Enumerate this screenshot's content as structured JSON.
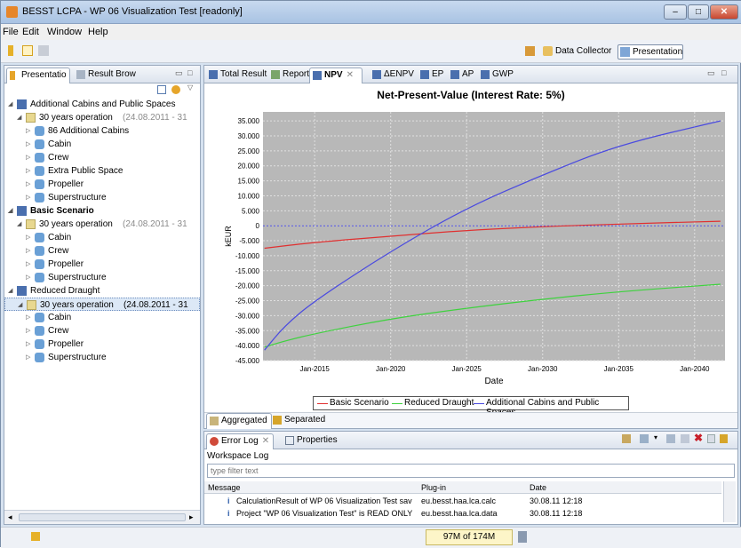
{
  "window": {
    "title": "BESST LCPA - WP 06 Visualization Test [readonly]"
  },
  "menu": [
    "File",
    "Edit",
    "Window",
    "Help"
  ],
  "perspectives": {
    "data_collector": "Data Collector",
    "presentation": "Presentation"
  },
  "left_panel": {
    "tabs": [
      "Presentatio",
      "Result Brow"
    ],
    "tree": [
      {
        "label": "Additional Cabins and Public Spaces",
        "bold": false
      },
      {
        "label": "30 years operation",
        "date": "(24.08.2011 - 31"
      },
      {
        "label": "86 Additional Cabins"
      },
      {
        "label": "Cabin"
      },
      {
        "label": "Crew"
      },
      {
        "label": "Extra Public Space"
      },
      {
        "label": "Propeller"
      },
      {
        "label": "Superstructure"
      },
      {
        "label": "Basic Scenario",
        "bold": true
      },
      {
        "label": "30 years operation",
        "date": "(24.08.2011 - 31"
      },
      {
        "label": "Cabin"
      },
      {
        "label": "Crew"
      },
      {
        "label": "Propeller"
      },
      {
        "label": "Superstructure"
      },
      {
        "label": "Reduced Draught"
      },
      {
        "label": "30 years operation",
        "date": "(24.08.2011 - 31"
      },
      {
        "label": "Cabin"
      },
      {
        "label": "Crew"
      },
      {
        "label": "Propeller"
      },
      {
        "label": "Superstructure"
      }
    ]
  },
  "editor_tabs": [
    "Total Result",
    "Report",
    "NPV",
    "ΔENPV",
    "EP",
    "AP",
    "GWP"
  ],
  "bottom_tabs": {
    "aggregated": "Aggregated",
    "separated": "Separated"
  },
  "chart_data": {
    "type": "line",
    "title": "Net-Present-Value (Interest Rate: 5%)",
    "xlabel": "Date",
    "ylabel": "kEUR",
    "x_ticks": [
      "Jan-2015",
      "Jan-2020",
      "Jan-2025",
      "Jan-2030",
      "Jan-2035",
      "Jan-2040"
    ],
    "y_ticks": [
      "35.000",
      "30.000",
      "25.000",
      "20.000",
      "15.000",
      "10.000",
      "5.000",
      "0",
      "-5.000",
      "-10.000",
      "-15.000",
      "-20.000",
      "-25.000",
      "-30.000",
      "-35.000",
      "-40.000",
      "-45.000"
    ],
    "xlim": [
      2011.6,
      2042.0
    ],
    "ylim": [
      -45000,
      38000
    ],
    "grid": true,
    "legend": "bottom",
    "zero_line": true,
    "series": [
      {
        "name": "Basic Scenario",
        "color": "#e03030",
        "x": [
          2011.7,
          2015,
          2020,
          2025,
          2030,
          2035,
          2041.7
        ],
        "y": [
          -7500,
          -5500,
          -3500,
          -1500,
          -300,
          600,
          1500
        ]
      },
      {
        "name": "Reduced Draught",
        "color": "#3ed23e",
        "x": [
          2011.7,
          2013,
          2015,
          2020,
          2025,
          2030,
          2035,
          2041.7
        ],
        "y": [
          -40500,
          -38500,
          -36000,
          -31000,
          -27500,
          -24500,
          -22000,
          -19500
        ]
      },
      {
        "name": "Additional Cabins and Public Spaces",
        "color": "#4a4ae0",
        "x": [
          2011.7,
          2013,
          2015,
          2020,
          2025,
          2030,
          2035,
          2041.7
        ],
        "y": [
          -41500,
          -33500,
          -25000,
          -8500,
          6000,
          17000,
          27000,
          35000
        ]
      }
    ]
  },
  "error_log": {
    "tab_label": "Error Log",
    "properties_label": "Properties",
    "workspace_log": "Workspace Log",
    "filter_placeholder": "type filter text",
    "columns": [
      "Message",
      "Plug-in",
      "Date"
    ],
    "rows": [
      {
        "message": "CalculationResult of WP 06 Visualization Test sav",
        "plugin": "eu.besst.haa.lca.calc",
        "date": "30.08.11 12:18"
      },
      {
        "message": "Project \"WP 06 Visualization Test\" is READ ONLY",
        "plugin": "eu.besst.haa.lca.data",
        "date": "30.08.11 12:18"
      }
    ]
  },
  "status": {
    "memory": "97M of 174M"
  }
}
